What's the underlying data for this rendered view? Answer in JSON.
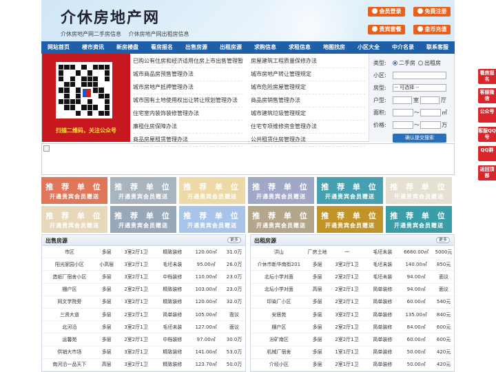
{
  "header": {
    "title": "介休房地产网",
    "links": [
      "介休房地产网二手房信息",
      "介休房地产网出租房信息"
    ],
    "buttons": [
      {
        "label": "会员登录",
        "icon": "user-icon"
      },
      {
        "label": "免费注册",
        "icon": "register-icon"
      },
      {
        "label": "贵宾套餐",
        "icon": "vip-icon"
      },
      {
        "label": "金币充值",
        "icon": "coin-icon"
      }
    ]
  },
  "nav": [
    "网站首页",
    "楼市资讯",
    "新房楼盘",
    "看房报名",
    "出售房源",
    "出租房源",
    "求购信息",
    "求租信息",
    "地图找房",
    "小区大全",
    "中介名录",
    "联系客服"
  ],
  "qr": {
    "caption": "扫描二维码，关注公众号"
  },
  "news_left": [
    "已购公有住房和经济适用住房上市出售管理暂",
    "城市商品房预售管理办法",
    "城市房地产抵押管理办法",
    "城市国有土地使用权出让转让规划管理办法",
    "住宅室内装饰装修管理办法",
    "廉租住房保障办法",
    "商品房屋租赁管理办法"
  ],
  "news_right": [
    "房屋建筑工程质量保修办法",
    "城市房地产转让管理规定",
    "城市危险房屋管理规定",
    "商品房销售管理办法",
    "城市建筑垃圾管理规定",
    "住宅专项维修资金管理办法",
    "公共租赁住房管理办法"
  ],
  "search": {
    "type_label": "类型:",
    "opt1": "二手房",
    "opt2": "出租房",
    "community_label": "小区:",
    "house_label": "房型:",
    "house_value": "-- 可选择 --",
    "layout_label": "户型:",
    "room_unit": "室",
    "hall_unit": "厅",
    "area_label": "面积:",
    "area_sep": "～",
    "area_unit": "㎡",
    "price_label": "价格:",
    "price_sep": "～",
    "price_unit": "万",
    "submit": "确认提交搜索"
  },
  "ads": {
    "line1": "推 荐 单 位",
    "line2": "开通贵宾会员赠送",
    "colors": [
      "#e0765a",
      "#a8b4be",
      "#ecd9a6",
      "#a0a8c8",
      "#45a0b0",
      "#e6e0d2",
      "#e8d8ba",
      "#98a8b8",
      "#a8c4e8",
      "#b4a68a",
      "#c09428",
      "#3a9ea8"
    ]
  },
  "sale": {
    "title": "出售房源",
    "more": "更多",
    "rows": [
      [
        "市区",
        "多层",
        "3室2厅1卫",
        "精致装修",
        "120.00㎡",
        "31.0万"
      ],
      [
        "阳光家园小区",
        "小高层",
        "3室2厅1卫",
        "毛坯未装",
        "95.00㎡",
        "26.0万"
      ],
      [
        "造纸厂宿舍小区",
        "多层",
        "3室2厅1卫",
        "中档装修",
        "110.00㎡",
        "23.0万"
      ],
      [
        "棚户区",
        "多层",
        "2室2厅1卫",
        "精致装修",
        "103.00㎡",
        "23.0万"
      ],
      [
        "同文学院旁",
        "多层",
        "3室2厅1卫",
        "精致装修",
        "120.00㎡",
        "32.0万"
      ],
      [
        "三贤大道",
        "多层",
        "2室2厅1卫",
        "简单装修",
        "105.00㎡",
        "面议"
      ],
      [
        "北河沿",
        "多层",
        "3室2厅1卫",
        "毛坯未装",
        "127.00㎡",
        "面议"
      ],
      [
        "运馨苑",
        "多层",
        "2室2厅1卫",
        "中档装修",
        "97.00㎡",
        "30.0万"
      ],
      [
        "供销大市场",
        "多层",
        "3室2厅1卫",
        "精致装修",
        "141.00㎡",
        "53.0万"
      ],
      [
        "南河沿一品天下",
        "高层",
        "3室2厅1卫",
        "精致装修",
        "123.70㎡",
        "50.0万"
      ]
    ]
  },
  "rent": {
    "title": "出租房源",
    "more": "更多",
    "rows": [
      [
        "洪山",
        "厂房土地",
        "一",
        "毛坯未装",
        "6660.00㎡",
        "5000元"
      ],
      [
        "介休市新华南街201",
        "多层",
        "3室2厅1卫",
        "毛坯未装",
        "140.00㎡",
        "850元"
      ],
      [
        "北坛小学对面",
        "多层",
        "2室2厅1卫",
        "毛坯未装",
        "94.00㎡",
        "面议"
      ],
      [
        "北坛小学对面",
        "高层",
        "2室2厅1卫",
        "简单装修",
        "94.00㎡",
        "面议"
      ],
      [
        "印染厂小区",
        "多层",
        "2室2厅1卫",
        "简单装修",
        "60.00㎡",
        "540元"
      ],
      [
        "安居苑",
        "多层",
        "3室2厅1卫",
        "简单装修",
        "135.00㎡",
        "840元"
      ],
      [
        "棚户区",
        "多层",
        "2室2厅1卫",
        "简单装修",
        "84.00㎡",
        "600元"
      ],
      [
        "汾矿南区",
        "多层",
        "2室2厅1卫",
        "简单装修",
        "60.00㎡",
        "600元"
      ],
      [
        "机械厂宿舍",
        "多层",
        "1室1厅1卫",
        "简单装修",
        "50.00㎡",
        "420元"
      ],
      [
        "介经小区",
        "多层",
        "2室1厅1卫",
        "简单装修",
        "50.00㎡",
        "420元"
      ]
    ]
  },
  "side": [
    {
      "label": "看房报名",
      "color": "#d9262c"
    },
    {
      "label": "客服微信",
      "color": "#d9262c"
    },
    {
      "label": "公众号",
      "color": "#d9262c"
    },
    {
      "label": "客服QQ号",
      "color": "#d9262c"
    },
    {
      "label": "QQ群",
      "color": "#d9262c"
    },
    {
      "label": "返回顶部",
      "color": "#d9262c"
    }
  ]
}
